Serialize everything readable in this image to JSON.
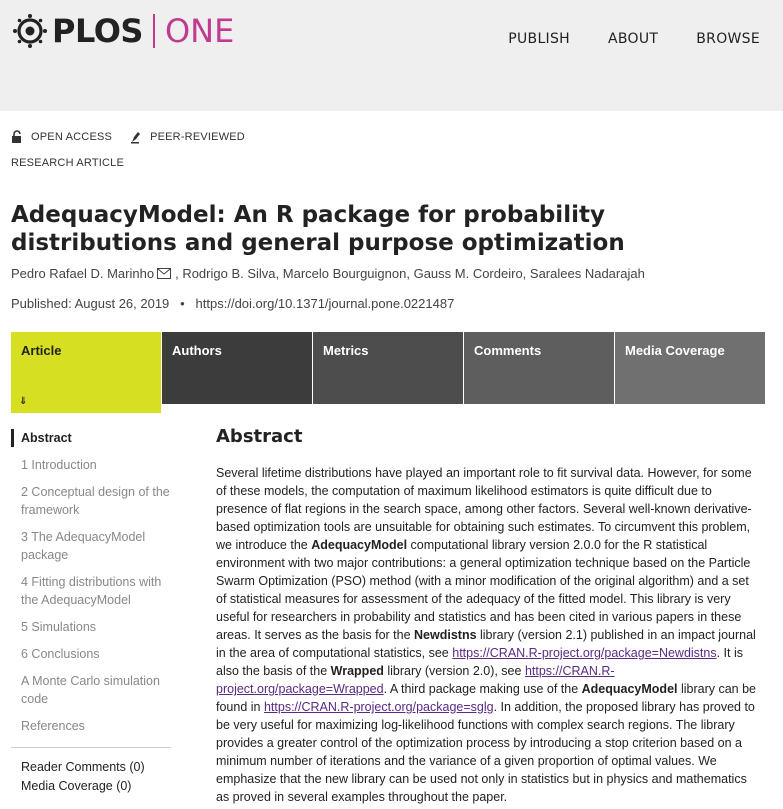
{
  "header": {
    "logo_plos": "PLOS",
    "logo_one": "ONE",
    "nav": [
      "PUBLISH",
      "ABOUT",
      "BROWSE"
    ]
  },
  "meta": {
    "open_access": "OPEN ACCESS",
    "peer_reviewed": "PEER-REVIEWED",
    "article_type": "RESEARCH ARTICLE"
  },
  "article": {
    "title": "AdequacyModel: An R package for probability distributions and general purpose optimization",
    "authors": [
      "Pedro Rafael D. Marinho",
      "Rodrigo B. Silva",
      "Marcelo Bourguignon",
      "Gauss M. Cordeiro",
      "Saralees Nadarajah"
    ],
    "published": "Published: August 26, 2019",
    "doi": "https://doi.org/10.1371/journal.pone.0221487"
  },
  "tabs": [
    "Article",
    "Authors",
    "Metrics",
    "Comments",
    "Media Coverage"
  ],
  "sidebar": {
    "toc": [
      "Abstract",
      "1 Introduction",
      "2 Conceptual design of the framework",
      "3 The AdequacyModel package",
      "4 Fitting distributions with the AdequacyModel",
      "5 Simulations",
      "6 Conclusions",
      "A Monte Carlo simulation code",
      "References"
    ],
    "reader_comments": "Reader Comments (0)",
    "media_coverage": "Media Coverage (0)"
  },
  "abstract": {
    "heading": "Abstract",
    "p1": "Several lifetime distributions have played an important role to fit survival data. However, for some of these models, the computation of maximum likelihood estimators is quite difficult due to presence of flat regions in the search space, among other factors. Several well-known derivative-based optimization tools are unsuitable for obtaining such estimates. To circumvent this problem, we introduce the ",
    "b1": "AdequacyModel",
    "p2": " computational library version 2.0.0 for the R statistical environment with two major contributions: a general optimization technique based on the Particle Swarm Optimization (PSO) method (with a minor modification of the original algorithm) and a set of statistical measures for assessment of the adequacy of the fitted model. This library is very useful for researchers in probability and statistics and has been cited in various papers in these areas. It serves as the basis for the ",
    "b2": "Newdistns",
    "p3": " library (version 2.1) published in an impact journal in the area of computational statistics, see ",
    "link1": "https://CRAN.R-project.org/package=Newdistns",
    "p4": ". It is also the basis of the ",
    "b3": "Wrapped",
    "p5": " library (version 2.0), see ",
    "link2": "https://CRAN.R-project.org/package=Wrapped",
    "p6": ". A third package making use of the ",
    "b4": "AdequacyModel",
    "p7": " library can be found in ",
    "link3": "https://CRAN.R-project.org/package=sglg",
    "p8": ". In addition, the proposed library has proved to be very useful for maximizing log-likelihood functions with complex search regions. The library provides a greater control of the optimization process by introducing a stop criterion based on a minimum number of iterations and the variance of a given proportion of optimal values. We emphasize that the new library can be used not only in statistics but in physics and mathematics as proved in several examples throughout the paper."
  }
}
